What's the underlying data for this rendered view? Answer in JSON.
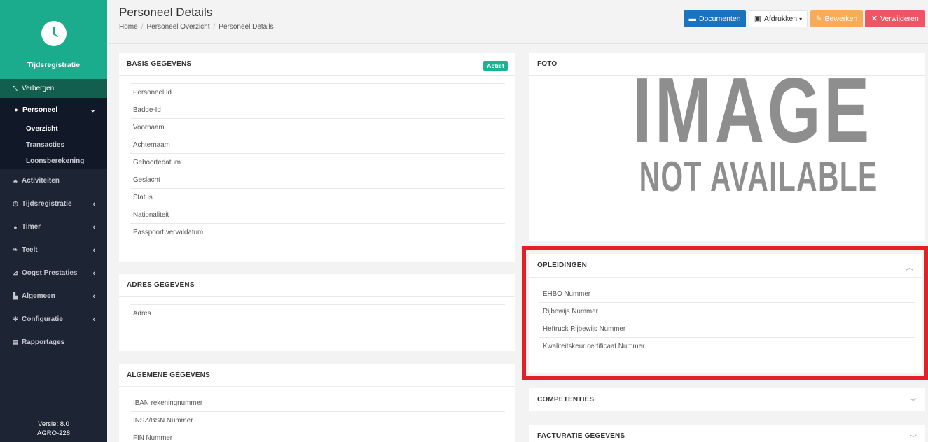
{
  "app": {
    "name": "Tijdsregistratie",
    "version_line1": "Versie: 8.0",
    "version_line2": "AGRO-228"
  },
  "sidebar": {
    "hide_label": "Verbergen",
    "active_group": "Personeel",
    "sub_items": [
      "Overzicht",
      "Transacties",
      "Loonsberekening"
    ],
    "items": [
      {
        "label": "Activiteiten"
      },
      {
        "label": "Tijdsregistratie"
      },
      {
        "label": "Timer"
      },
      {
        "label": "Teelt"
      },
      {
        "label": "Oogst Prestaties"
      },
      {
        "label": "Algemeen"
      },
      {
        "label": "Configuratie"
      },
      {
        "label": "Rapportages"
      }
    ]
  },
  "page": {
    "title": "Personeel Details",
    "breadcrumb": [
      "Home",
      "Personeel Overzicht",
      "Personeel Details"
    ]
  },
  "toolbar": {
    "documenten": "Documenten",
    "afdrukken": "Afdrukken",
    "bewerken": "Bewerken",
    "verwijderen": "Verwijderen"
  },
  "basis": {
    "title": "BASIS GEGEVENS",
    "badge": "Actief",
    "fields": [
      "Personeel Id",
      "Badge-Id",
      "Voornaam",
      "Achternaam",
      "Geboortedatum",
      "Geslacht",
      "Status",
      "Nationaliteit",
      "Passpoort vervaldatum"
    ]
  },
  "adres": {
    "title": "ADRES GEGEVENS",
    "fields": [
      "Adres"
    ]
  },
  "algemeen": {
    "title": "ALGEMENE GEGEVENS",
    "fields": [
      "IBAN rekeningnummer",
      "INSZ/BSN Nummer",
      "FIN Nummer"
    ]
  },
  "foto": {
    "title": "FOTO",
    "placeholder_line1": "IMAGE",
    "placeholder_line2": "NOT AVAILABLE"
  },
  "opleidingen": {
    "title": "OPLEIDINGEN",
    "fields": [
      "EHBO Nummer",
      "Rijbewijs Nummer",
      "Heftruck Rijbewijs Nummer",
      "Kwaliteitskeur certificaat Nummer"
    ]
  },
  "competenties": {
    "title": "COMPETENTIES"
  },
  "facturatie": {
    "title": "FACTURATIE GEGEVENS"
  }
}
